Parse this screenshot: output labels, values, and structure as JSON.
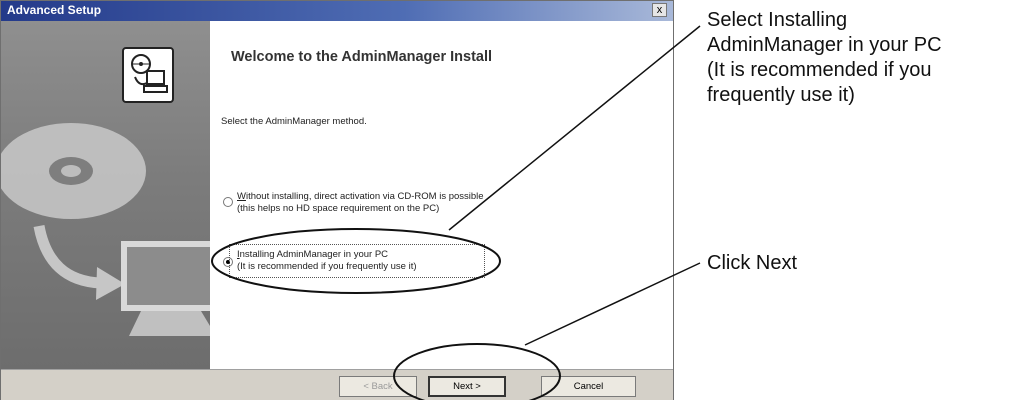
{
  "dialog": {
    "title": "Advanced Setup",
    "close_label": "x",
    "heading": "Welcome to the AdminManager Install",
    "instruction": "Select the AdminManager method.",
    "options": [
      {
        "line1_mnemonic": "W",
        "line1_rest": "ithout installing, direct activation via CD-ROM is possible",
        "line2": "(this helps no HD space requirement on the PC)",
        "selected": false
      },
      {
        "line1_mnemonic": "I",
        "line1_rest": "nstalling AdminManager in your PC",
        "line2": "(It is recommended if you frequently use it)",
        "selected": true
      }
    ],
    "buttons": {
      "back": "< Back",
      "next": "Next >",
      "cancel": "Cancel"
    }
  },
  "annotations": {
    "select_note": [
      "Select Installing",
      "AdminManager in your PC",
      "(It is recommended if you",
      "frequently use it)"
    ],
    "next_note": "Click Next"
  },
  "icons": [
    "setup-computer-icon",
    "cd-disc-icon",
    "curved-arrow-icon",
    "monitor-icon"
  ]
}
